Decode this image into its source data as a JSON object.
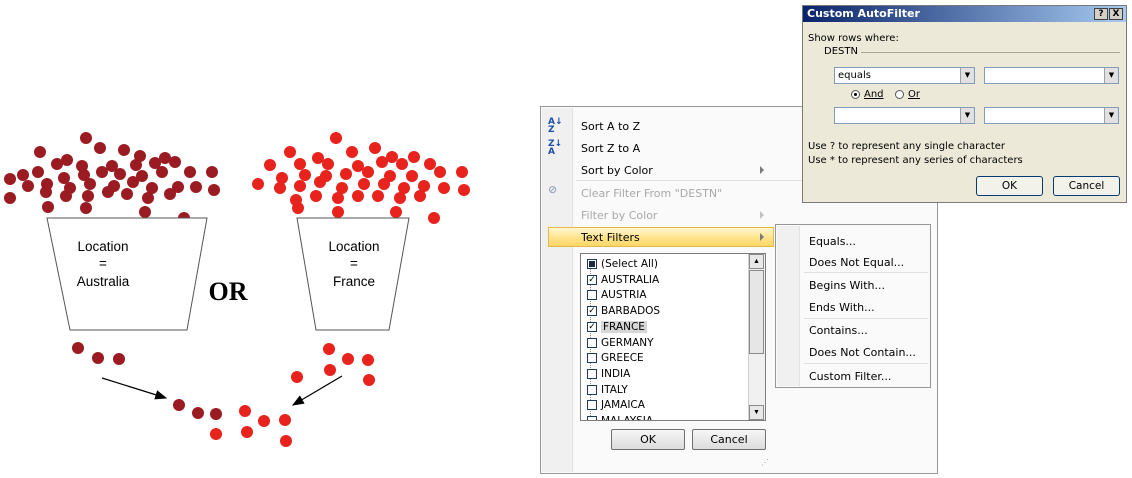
{
  "illustration": {
    "left_funnel_label": [
      "Location",
      "=",
      "Australia"
    ],
    "right_funnel_label": [
      "Location",
      "=",
      "France"
    ],
    "operator_text": "OR",
    "colors": {
      "australia_dot": "#9b1b22",
      "france_dot": "#e8231d"
    }
  },
  "filter_menu": {
    "items": [
      {
        "label": "Sort A to Z",
        "icon": "sort-a-z-icon",
        "enabled": true
      },
      {
        "label": "Sort Z to A",
        "icon": "sort-z-a-icon",
        "enabled": true
      },
      {
        "label": "Sort by Color",
        "enabled": true,
        "submenu": true
      },
      {
        "label": "Clear Filter From \"DESTN\"",
        "icon": "clear-filter-icon",
        "enabled": false
      },
      {
        "label": "Filter by Color",
        "enabled": false,
        "submenu": true
      },
      {
        "label": "Text Filters",
        "enabled": true,
        "submenu": true,
        "highlighted": true
      }
    ],
    "values": [
      {
        "label": "(Select All)",
        "state": "partial"
      },
      {
        "label": "AUSTRALIA",
        "state": "checked"
      },
      {
        "label": "AUSTRIA",
        "state": "unchecked"
      },
      {
        "label": "BARBADOS",
        "state": "checked"
      },
      {
        "label": "FRANCE",
        "state": "checked",
        "selected": true
      },
      {
        "label": "GERMANY",
        "state": "unchecked"
      },
      {
        "label": "GREECE",
        "state": "unchecked"
      },
      {
        "label": "INDIA",
        "state": "unchecked"
      },
      {
        "label": "ITALY",
        "state": "unchecked"
      },
      {
        "label": "JAMAICA",
        "state": "unchecked"
      },
      {
        "label": "MALAYSIA",
        "state": "unchecked"
      }
    ],
    "ok_label": "OK",
    "cancel_label": "Cancel",
    "highlight_color": "#ffe38a"
  },
  "text_filters_submenu": {
    "items": [
      "Equals...",
      "Does Not Equal...",
      "Begins With...",
      "Ends With...",
      "Contains...",
      "Does Not Contain...",
      "Custom Filter..."
    ]
  },
  "custom_autofilter": {
    "title": "Custom AutoFilter",
    "help_label": "?",
    "close_label": "X",
    "show_rows_label": "Show rows where:",
    "field_name": "DESTN",
    "operator1": "equals",
    "value1": "",
    "and_label": "And",
    "or_label": "Or",
    "join": "and",
    "operator2": "",
    "value2": "",
    "hint1": "Use ? to represent any single character",
    "hint2": "Use * to represent any series of characters",
    "ok_label": "OK",
    "cancel_label": "Cancel",
    "titlebar_color": "#0a246a"
  }
}
